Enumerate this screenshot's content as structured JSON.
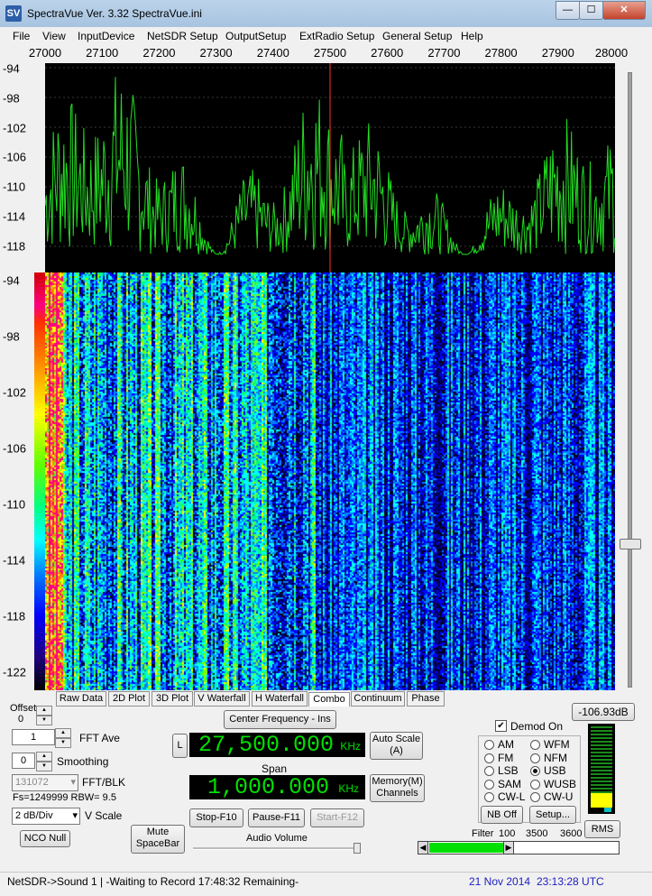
{
  "window": {
    "title": "SpectraVue Ver. 3.32   SpectraVue.ini",
    "icon": "SV",
    "min": "—",
    "max": "☐",
    "close": "✕"
  },
  "menu": [
    "File",
    "View",
    "InputDevice",
    "NetSDR Setup",
    "OutputSetup",
    "ExtRadio Setup",
    "General Setup",
    "Help"
  ],
  "freq_ticks": [
    "27000",
    "27100",
    "27200",
    "27300",
    "27400",
    "27500",
    "27600",
    "27700",
    "27800",
    "27900",
    "28000"
  ],
  "spectrum_db_ticks": [
    "-94",
    "-98",
    "-102",
    "-106",
    "-110",
    "-114",
    "-118"
  ],
  "waterfall_db_ticks": [
    "-94",
    "-98",
    "-102",
    "-106",
    "-110",
    "-114",
    "-118",
    "-122"
  ],
  "tabs": [
    "Raw Data",
    "2D Plot",
    "3D Plot",
    "V Waterfall",
    "H Waterfall",
    "Combo",
    "Continuum",
    "Phase"
  ],
  "active_tab": "Combo",
  "controls": {
    "offset_label": "Offset",
    "offset_value": "0",
    "fft_ave_value": "1",
    "fft_ave_label": "FFT Ave",
    "smoothing_value": "0",
    "smoothing_label": "Smoothing",
    "fft_blk_value": "131072",
    "fft_blk_label": "FFT/BLK",
    "fs_rbw": "Fs=1249999 RBW= 9.5",
    "vscale_value": "2 dB/Div",
    "vscale_label": "V Scale",
    "nco_null": "NCO Null",
    "mute_line1": "Mute",
    "mute_line2": "SpaceBar",
    "center_freq_btn": "Center Frequency - Ins",
    "l_btn": "L",
    "center_freq_value": "27,500.000",
    "khz": "KHz",
    "span_label": "Span",
    "span_value": "1,000.000",
    "auto_scale_line1": "Auto Scale",
    "auto_scale_line2": "(A)",
    "memory_line1": "Memory(M)",
    "memory_line2": "Channels",
    "stop": "Stop-F10",
    "pause": "Pause-F11",
    "start": "Start-F12",
    "audio_volume": "Audio Volume",
    "level_db": "-106.93dB",
    "demod_on": "Demod On",
    "nb_off": "NB Off",
    "setup": "Setup...",
    "rms": "RMS",
    "filter_label": "Filter",
    "filter_values": [
      "100",
      "3500",
      "3600"
    ]
  },
  "demod_modes": [
    {
      "label": "AM",
      "selected": false
    },
    {
      "label": "WFM",
      "selected": false
    },
    {
      "label": "FM",
      "selected": false
    },
    {
      "label": "NFM",
      "selected": false
    },
    {
      "label": "LSB",
      "selected": false
    },
    {
      "label": "USB",
      "selected": true
    },
    {
      "label": "SAM",
      "selected": false
    },
    {
      "label": "WUSB",
      "selected": false
    },
    {
      "label": "CW-L",
      "selected": false
    },
    {
      "label": "CW-U",
      "selected": false
    }
  ],
  "status": {
    "left": "NetSDR->Sound 1  | -Waiting to Record 17:48:32 Remaining-",
    "date": "21 Nov 2014",
    "time": "23:13:28 UTC"
  },
  "colors": {
    "trace": "#22dd22",
    "lcd_green": "#00e000",
    "accent_blue": "#2020c0"
  }
}
